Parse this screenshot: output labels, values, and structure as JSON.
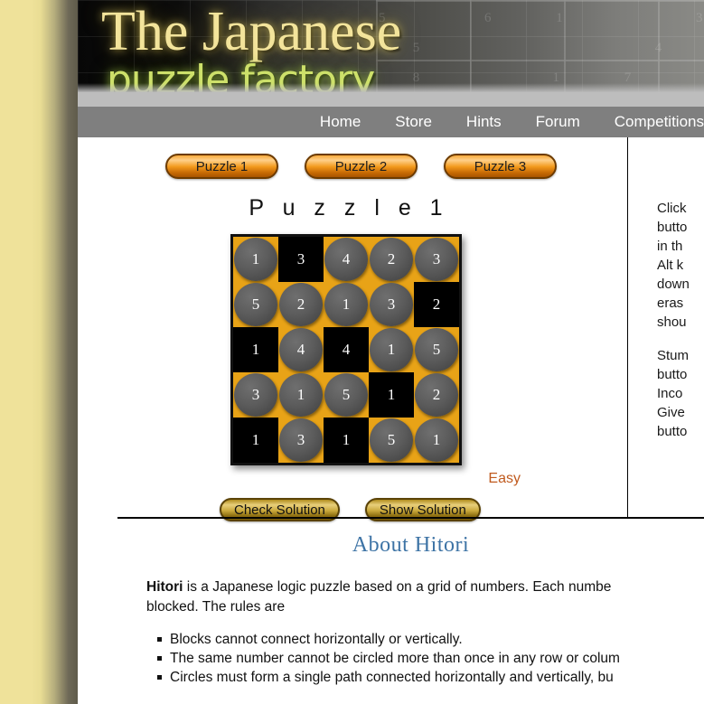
{
  "site": {
    "logo_line1": "The Japanese",
    "logo_line2": "puzzle factory"
  },
  "nav": {
    "items": [
      {
        "label": "Home"
      },
      {
        "label": "Store"
      },
      {
        "label": "Hints"
      },
      {
        "label": "Forum"
      },
      {
        "label": "Competitions"
      }
    ]
  },
  "puzzle_selector": {
    "buttons": [
      {
        "label": "Puzzle 1"
      },
      {
        "label": "Puzzle 2"
      },
      {
        "label": "Puzzle 3"
      }
    ]
  },
  "puzzle": {
    "title": "P u z z l e   1",
    "difficulty": "Easy",
    "size": 5,
    "grid": [
      [
        {
          "value": "1",
          "state": "circled"
        },
        {
          "value": "3",
          "state": "blocked"
        },
        {
          "value": "4",
          "state": "circled"
        },
        {
          "value": "2",
          "state": "circled"
        },
        {
          "value": "3",
          "state": "circled"
        }
      ],
      [
        {
          "value": "5",
          "state": "circled"
        },
        {
          "value": "2",
          "state": "circled"
        },
        {
          "value": "1",
          "state": "circled"
        },
        {
          "value": "3",
          "state": "circled"
        },
        {
          "value": "2",
          "state": "blocked"
        }
      ],
      [
        {
          "value": "1",
          "state": "blocked"
        },
        {
          "value": "4",
          "state": "circled"
        },
        {
          "value": "4",
          "state": "blocked"
        },
        {
          "value": "1",
          "state": "circled"
        },
        {
          "value": "5",
          "state": "circled"
        }
      ],
      [
        {
          "value": "3",
          "state": "circled"
        },
        {
          "value": "1",
          "state": "circled"
        },
        {
          "value": "5",
          "state": "circled"
        },
        {
          "value": "1",
          "state": "blocked"
        },
        {
          "value": "2",
          "state": "circled"
        }
      ],
      [
        {
          "value": "1",
          "state": "blocked"
        },
        {
          "value": "3",
          "state": "circled"
        },
        {
          "value": "1",
          "state": "blocked"
        },
        {
          "value": "5",
          "state": "circled"
        },
        {
          "value": "1",
          "state": "circled"
        }
      ]
    ]
  },
  "actions": {
    "check_label": "Check Solution",
    "show_label": "Show Solution"
  },
  "sidebar": {
    "paragraph1_lines": [
      "Click",
      "butto",
      "in th",
      "Alt k",
      "down",
      "eras",
      "shou"
    ],
    "paragraph2_lines": [
      "Stum",
      "butto",
      "Inco",
      "Give",
      "butto"
    ]
  },
  "about": {
    "heading": "About Hitori",
    "intro_bold": "Hitori",
    "intro_line1": " is a Japanese logic puzzle based on a grid of numbers. Each numbe",
    "intro_line2": "blocked. The rules are",
    "rules": [
      "Blocks cannot connect horizontally or vertically.",
      "The same number cannot be circled more than once in any row or colum",
      "Circles must form a single path connected horizontally and vertically, bu"
    ]
  },
  "colors": {
    "grid_background": "#e8a317",
    "blocked_cell": "#000000",
    "circle_fill": "#5c5c5c",
    "nav_background": "#7f7f7f",
    "heading_blue": "#3d73a5",
    "difficulty_orange": "#c05a1e",
    "logo_gold": "#f3e49b",
    "logo_green": "#cde06a"
  }
}
